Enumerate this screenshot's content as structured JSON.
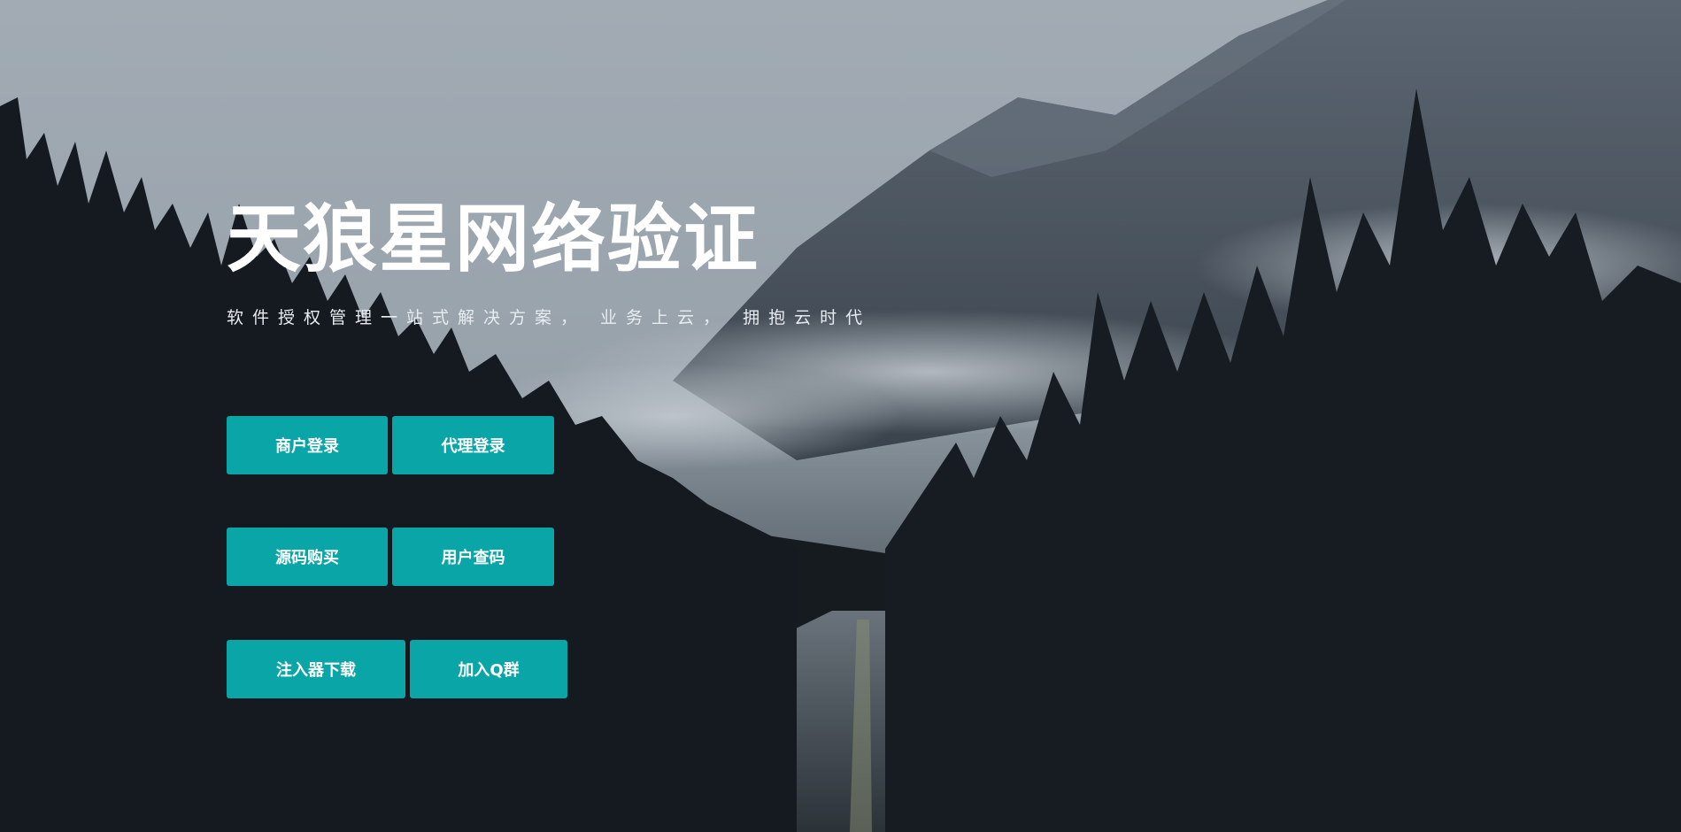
{
  "hero": {
    "title": "天狼星网络验证",
    "subtitle": "软件授权管理一站式解决方案， 业务上云， 拥抱云时代"
  },
  "buttons": {
    "merchant_login": "商户登录",
    "agent_login": "代理登录",
    "source_purchase": "源码购买",
    "user_query": "用户查码",
    "injector_download": "注入器下载",
    "join_qq_group": "加入Q群"
  },
  "colors": {
    "accent": "#0aa5a6",
    "text": "#ffffff"
  }
}
